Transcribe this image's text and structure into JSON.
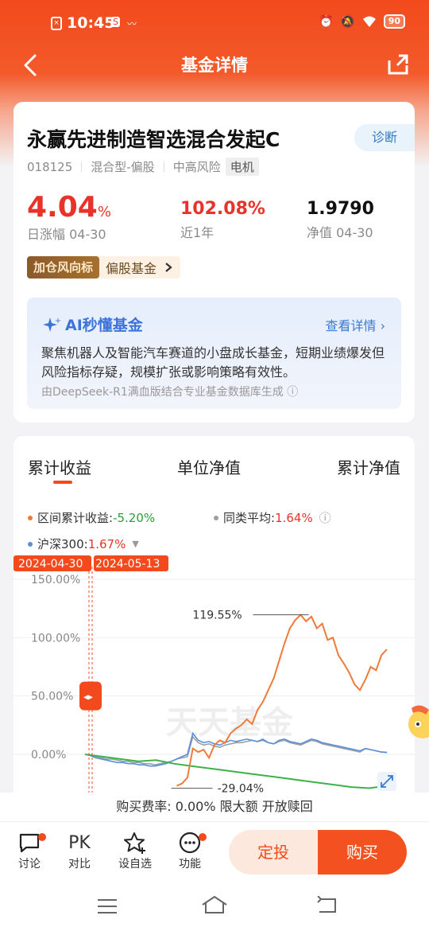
{
  "status_bar": {
    "time": "10:45",
    "battery": "90"
  },
  "nav": {
    "title": "基金详情"
  },
  "fund": {
    "name": "永赢先进制造智选混合发起C",
    "code": "018125",
    "type": "混合型-偏股",
    "risk": "中高风险",
    "sector_tag": "电机",
    "diagnose_label": "诊断",
    "daily_change": "4.04",
    "daily_change_unit": "%",
    "daily_change_label": "日涨幅  04-30",
    "one_year": "102.08%",
    "one_year_label": "近1年",
    "nav_value": "1.9790",
    "nav_label": "净值  04-30",
    "windvane_badge": "加仓风向标",
    "windvane_text": "偏股基金"
  },
  "ai": {
    "title": "AI秒懂基金",
    "more": "查看详情",
    "summary": "聚焦机器人及智能汽车赛道的小盘成长基金，短期业绩爆发但风险指标存疑，规模扩张或影响策略有效性。",
    "source": "由DeepSeek-R1满血版结合专业基金数据库生成"
  },
  "chart_tabs": [
    "累计收益",
    "单位净值",
    "累计净值"
  ],
  "legend": {
    "fund_label": "区间累计收益:",
    "fund_value": "-5.20%",
    "avg_label": "同类平均:",
    "avg_value": "1.64%",
    "index_label": "沪深300:",
    "index_value": "1.67%"
  },
  "colors": {
    "fund": "#f07a3a",
    "avg": "#9aa0a6",
    "index": "#5b8fd6",
    "green_segment": "#3db24a",
    "accent": "#f24a1c"
  },
  "chart_data": {
    "type": "line",
    "range_start_label": "2024-04-30",
    "range_end_label": "2024-05-13",
    "ylim": [
      -30,
      150
    ],
    "yticks": [
      "150.00%",
      "100.00%",
      "50.00%",
      "0.00%"
    ],
    "ytick_values": [
      150,
      100,
      50,
      0
    ],
    "max_annotation": "119.55%",
    "max_value": 119.55,
    "min_annotation": "-29.04%",
    "min_value": -29.04,
    "watermark": "天天基金",
    "series": [
      {
        "values": [
          0,
          -2,
          -4,
          -6,
          -5,
          -8,
          -10,
          -12,
          -14,
          -16,
          -18,
          -20,
          -22,
          -24,
          -26,
          -28,
          -29,
          -27,
          -25,
          -20,
          5,
          2,
          4,
          -3,
          8,
          12,
          10,
          18,
          22,
          25,
          30,
          26,
          38,
          45,
          55,
          65,
          80,
          95,
          108,
          115,
          119.55,
          114,
          118,
          108,
          112,
          98,
          100,
          85,
          78,
          70,
          60,
          55,
          64,
          75,
          72,
          85,
          90
        ]
      },
      {
        "values": [
          0,
          -1,
          -2,
          -3,
          -4,
          -4,
          -5,
          -6,
          -6,
          -7,
          -7,
          -8,
          -8,
          -9,
          -8,
          -7,
          -6,
          -4,
          -3,
          -2,
          15,
          10,
          8,
          9,
          7,
          6,
          8,
          9,
          10,
          10,
          11,
          12,
          11,
          12,
          10,
          9,
          11,
          12,
          10,
          9,
          8,
          10,
          12,
          11,
          9,
          8,
          7,
          6,
          5,
          4,
          3,
          2,
          5,
          4,
          3,
          2,
          1.64
        ]
      },
      {
        "values": [
          0,
          -1,
          -3,
          -4,
          -5,
          -6,
          -7,
          -7,
          -8,
          -8,
          -9,
          -9,
          -10,
          -10,
          -9,
          -8,
          -6,
          -4,
          -2,
          0,
          18,
          12,
          10,
          11,
          9,
          8,
          10,
          12,
          11,
          12,
          13,
          12,
          11,
          13,
          10,
          9,
          12,
          13,
          11,
          10,
          9,
          11,
          13,
          12,
          10,
          9,
          8,
          7,
          6,
          5,
          4,
          3,
          5,
          4,
          3,
          2,
          1.67
        ]
      }
    ]
  },
  "fee_bar": {
    "text": "购买费率: 0.00%  限大额  开放赎回"
  },
  "bottom_bar": {
    "discuss": "讨论",
    "compare_icon_text": "PK",
    "compare": "对比",
    "watchlist": "设自选",
    "functions": "功能",
    "fixed_invest": "定投",
    "buy": "购买"
  }
}
